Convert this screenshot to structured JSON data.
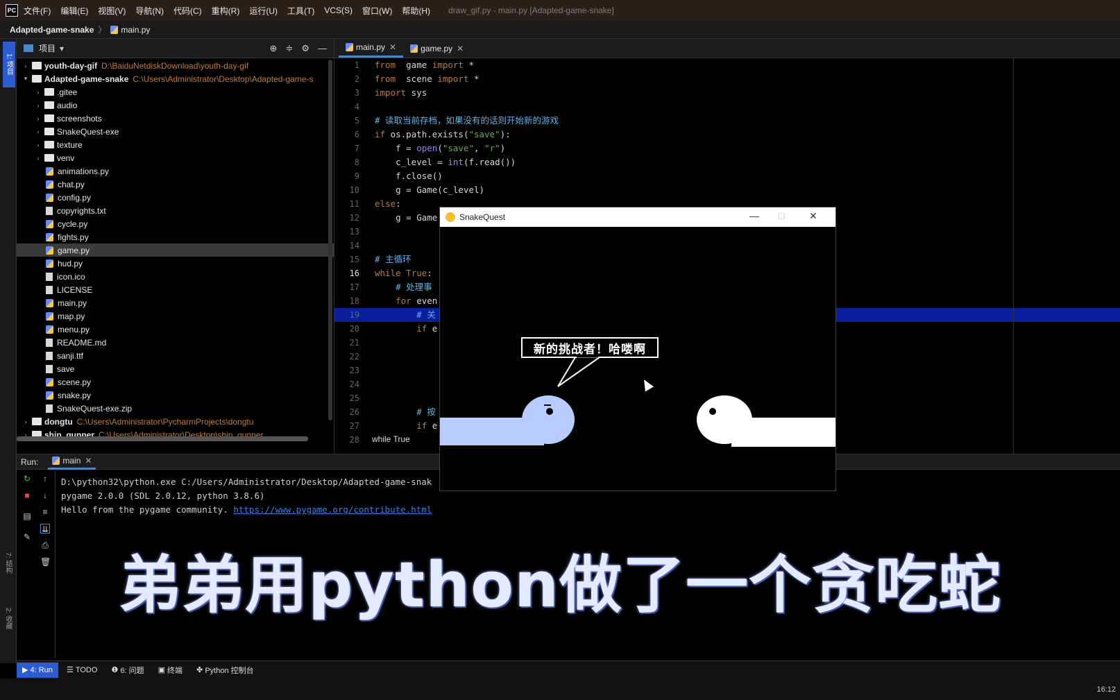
{
  "menubar": {
    "logo": "PC",
    "items": [
      "文件(F)",
      "编辑(E)",
      "视图(V)",
      "导航(N)",
      "代码(C)",
      "重构(R)",
      "运行(U)",
      "工具(T)",
      "VCS(S)",
      "窗口(W)",
      "帮助(H)"
    ],
    "window_title": "draw_gif.py - main.py [Adapted-game-snake]"
  },
  "breadcrumb": {
    "project": "Adapted-game-snake",
    "file": "main.py"
  },
  "left_strip": {
    "project": "1: 项目",
    "structure": "7: 结构",
    "favorites": "2: 收藏"
  },
  "project_panel": {
    "title": "项目",
    "tree": [
      {
        "name": "youth-day-gif",
        "path": "D:\\BaiduNetdiskDownload\\youth-day-gif",
        "type": "folder",
        "level": 0,
        "expanded": false,
        "bold": true
      },
      {
        "name": "Adapted-game-snake",
        "path": "C:\\Users\\Administrator\\Desktop\\Adapted-game-s",
        "type": "folder",
        "level": 0,
        "expanded": true,
        "bold": true
      },
      {
        "name": ".gitee",
        "path": "",
        "type": "folder",
        "level": 1,
        "expanded": false
      },
      {
        "name": "audio",
        "path": "",
        "type": "folder",
        "level": 1,
        "expanded": false
      },
      {
        "name": "screenshots",
        "path": "",
        "type": "folder",
        "level": 1,
        "expanded": false
      },
      {
        "name": "SnakeQuest-exe",
        "path": "",
        "type": "folder",
        "level": 1,
        "expanded": false
      },
      {
        "name": "texture",
        "path": "",
        "type": "folder",
        "level": 1,
        "expanded": false
      },
      {
        "name": "venv",
        "path": "",
        "type": "folder",
        "level": 1,
        "expanded": false
      },
      {
        "name": "animations.py",
        "path": "",
        "type": "py",
        "level": 1
      },
      {
        "name": "chat.py",
        "path": "",
        "type": "py",
        "level": 1
      },
      {
        "name": "config.py",
        "path": "",
        "type": "py",
        "level": 1
      },
      {
        "name": "copyrights.txt",
        "path": "",
        "type": "file",
        "level": 1
      },
      {
        "name": "cycle.py",
        "path": "",
        "type": "py",
        "level": 1
      },
      {
        "name": "fights.py",
        "path": "",
        "type": "py",
        "level": 1
      },
      {
        "name": "game.py",
        "path": "",
        "type": "py",
        "level": 1,
        "selected": true
      },
      {
        "name": "hud.py",
        "path": "",
        "type": "py",
        "level": 1
      },
      {
        "name": "icon.ico",
        "path": "",
        "type": "file",
        "level": 1
      },
      {
        "name": "LICENSE",
        "path": "",
        "type": "file",
        "level": 1
      },
      {
        "name": "main.py",
        "path": "",
        "type": "py",
        "level": 1
      },
      {
        "name": "map.py",
        "path": "",
        "type": "py",
        "level": 1
      },
      {
        "name": "menu.py",
        "path": "",
        "type": "py",
        "level": 1
      },
      {
        "name": "README.md",
        "path": "",
        "type": "file",
        "level": 1
      },
      {
        "name": "sanji.ttf",
        "path": "",
        "type": "file",
        "level": 1
      },
      {
        "name": "save",
        "path": "",
        "type": "file",
        "level": 1
      },
      {
        "name": "scene.py",
        "path": "",
        "type": "py",
        "level": 1
      },
      {
        "name": "snake.py",
        "path": "",
        "type": "py",
        "level": 1
      },
      {
        "name": "SnakeQuest-exe.zip",
        "path": "",
        "type": "file",
        "level": 1
      },
      {
        "name": "dongtu",
        "path": "C:\\Users\\Administrator\\PycharmProjects\\dongtu",
        "type": "folder",
        "level": 0,
        "expanded": false,
        "bold": true
      },
      {
        "name": "ship_gunner",
        "path": "C:\\Users\\Administrator\\Desktop\\ship_gunner",
        "type": "folder",
        "level": 0,
        "expanded": false,
        "bold": true
      }
    ]
  },
  "editor": {
    "tabs": [
      {
        "label": "main.py",
        "active": true
      },
      {
        "label": "game.py",
        "active": false
      }
    ],
    "current_line": 16,
    "line_numbers": [
      "1",
      "2",
      "3",
      "4",
      "5",
      "6",
      "7",
      "8",
      "9",
      "10",
      "11",
      "12",
      "13",
      "14",
      "15",
      "16",
      "17",
      "18",
      "19",
      "20",
      "21",
      "22",
      "23",
      "24",
      "25",
      "26",
      "27",
      "28"
    ],
    "breadcrumb": "while True",
    "lines": [
      [
        [
          "kw",
          "from"
        ],
        [
          "",
          "  game "
        ],
        [
          "kw",
          "import"
        ],
        [
          "",
          " *"
        ]
      ],
      [
        [
          "kw",
          "from"
        ],
        [
          "",
          "  scene "
        ],
        [
          "kw",
          "import"
        ],
        [
          "",
          " *"
        ]
      ],
      [
        [
          "kw",
          "import"
        ],
        [
          "",
          " sys"
        ]
      ],
      [],
      [
        [
          "cm",
          "# 读取当前存档，如果没有的话则开始新的游戏"
        ]
      ],
      [
        [
          "kw",
          "if"
        ],
        [
          "",
          " os.path.exists("
        ],
        [
          "str",
          "\"save\""
        ],
        [
          "",
          "):"
        ]
      ],
      [
        [
          "",
          "    f = "
        ],
        [
          "fn",
          "open"
        ],
        [
          "",
          "("
        ],
        [
          "str",
          "\"save\""
        ],
        [
          "",
          ", "
        ],
        [
          "str",
          "\"r\""
        ],
        [
          "",
          ")"
        ]
      ],
      [
        [
          "",
          "    c_level = "
        ],
        [
          "fn",
          "int"
        ],
        [
          "",
          "(f.read())"
        ]
      ],
      [
        [
          "",
          "    f.close()"
        ]
      ],
      [
        [
          "",
          "    g = Game(c_level)"
        ]
      ],
      [
        [
          "kw",
          "else"
        ],
        [
          "",
          ":"
        ]
      ],
      [
        [
          "",
          "    g = Game"
        ]
      ],
      [],
      [],
      [
        [
          "cm",
          "# 主循环"
        ]
      ],
      [
        [
          "kw",
          "while"
        ],
        [
          "",
          " "
        ],
        [
          "kw",
          "True"
        ],
        [
          "",
          ":"
        ]
      ],
      [
        [
          "cm",
          "    # 处理事"
        ]
      ],
      [
        [
          "kw",
          "    for"
        ],
        [
          "",
          " even"
        ]
      ],
      [
        [
          "cm",
          "        # 关"
        ]
      ],
      [
        [
          "kw",
          "        if"
        ],
        [
          "",
          " e"
        ]
      ],
      [],
      [],
      [],
      [],
      [],
      [
        [
          "cm",
          "        # 按"
        ]
      ],
      [
        [
          "kw",
          "        if"
        ],
        [
          "",
          " e"
        ]
      ],
      []
    ]
  },
  "run_panel": {
    "label": "Run:",
    "tab": "main",
    "console": [
      "D:\\python32\\python.exe C:/Users/Administrator/Desktop/Adapted-game-snak",
      "pygame 2.0.0 (SDL 2.0.12, python 3.8.6)",
      "Hello from the pygame community. "
    ],
    "console_link": "https://www.pygame.org/contribute.html"
  },
  "caption": "弟弟用python做了一个贪吃蛇",
  "game_window": {
    "title": "SnakeQuest",
    "minimize": "—",
    "maximize": "□",
    "close": "✕",
    "speech": "新的挑战者！哈喽啊",
    "player_color": "#b8ccff",
    "enemy_color": "#ffffff"
  },
  "statusbar": {
    "tabs": [
      "4: Run",
      "TODO",
      "6: 问题",
      "终端",
      "Python 控制台"
    ],
    "time": "16:12"
  },
  "colors": {
    "accent": "#2d5bd1",
    "current_line": "#0a1f9e",
    "menubar": "#2b1f1a"
  }
}
